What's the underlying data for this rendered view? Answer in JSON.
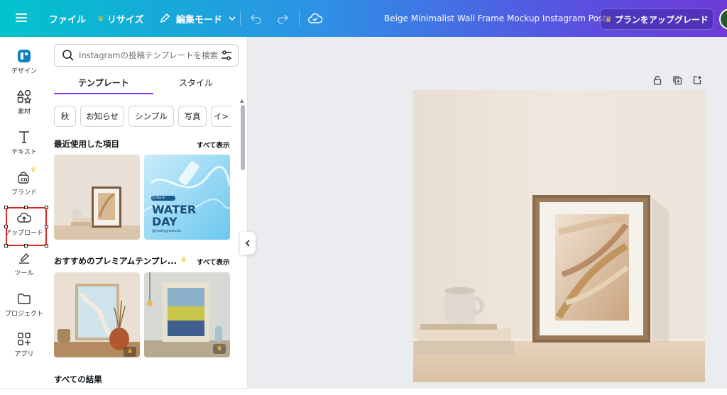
{
  "topbar": {
    "file_label": "ファイル",
    "resize_label": "リサイズ",
    "edit_mode_label": "編集モード",
    "title": "Beige Minimalist Wall Frame Mockup Instagram Post",
    "upgrade_label": "プランをアップグレード"
  },
  "rail": {
    "items": [
      {
        "label": "デザイン",
        "icon": "design-icon"
      },
      {
        "label": "素材",
        "icon": "elements-icon"
      },
      {
        "label": "テキスト",
        "icon": "text-icon"
      },
      {
        "label": "ブランド",
        "icon": "brand-icon"
      },
      {
        "label": "アップロード",
        "icon": "upload-icon"
      },
      {
        "label": "ツール",
        "icon": "draw-icon"
      },
      {
        "label": "プロジェクト",
        "icon": "folder-icon"
      },
      {
        "label": "アプリ",
        "icon": "apps-icon"
      }
    ]
  },
  "panel": {
    "search_placeholder": "Instagramの投稿テンプレートを検索",
    "tabs": [
      {
        "label": "テンプレート",
        "active": true
      },
      {
        "label": "スタイル",
        "active": false
      }
    ],
    "chips": [
      "秋",
      "お知らせ",
      "シンプル",
      "写真",
      "イ>"
    ],
    "recent": {
      "title": "最近使用した項目",
      "see_all": "すべて表示",
      "items": [
        {
          "name": "frame-mockup",
          "text": ""
        },
        {
          "name": "water-day",
          "badge": "22 March",
          "title_line1": "WATER",
          "title_line2": "DAY",
          "handle": "@reallygreatsite"
        }
      ]
    },
    "premium": {
      "title": "おすすめのプレミアムテンプレ...",
      "see_all": "すべて表示"
    },
    "all_results_title": "すべての結果"
  },
  "colors": {
    "accent": "#8b3dff",
    "crown": "#f8c53a",
    "selection": "#e02424"
  }
}
